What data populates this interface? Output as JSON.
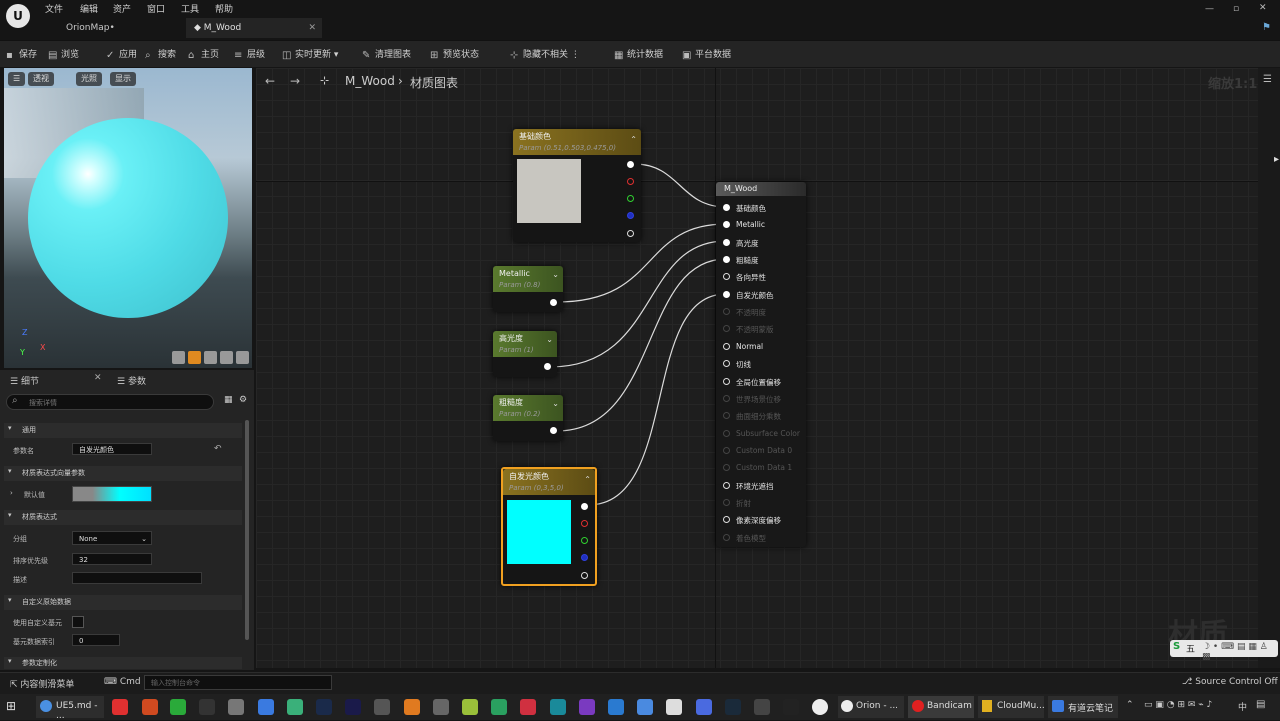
{
  "menubar": {
    "items": [
      "文件",
      "编辑",
      "资产",
      "窗口",
      "工具",
      "帮助"
    ],
    "tabs": [
      {
        "label": "OrionMap•"
      },
      {
        "label": "M_Wood"
      }
    ]
  },
  "toolbar": {
    "items": [
      "保存",
      "浏览",
      "应用",
      "搜索",
      "主页",
      "层级",
      "实时更新",
      "清理图表",
      "预览状态",
      "隐藏不相关",
      "统计数据",
      "平台数据"
    ]
  },
  "viewport": {
    "buttons": [
      "透视",
      "光照",
      "显示"
    ]
  },
  "details": {
    "tabs": [
      "细节",
      "参数"
    ],
    "search_placeholder": "搜索详情",
    "sections": {
      "general": "通用",
      "vector_param": "材质表达式向量参数",
      "expression": "材质表达式",
      "custom_primitive": "自定义原始数据",
      "param_custom": "参数定制化"
    },
    "param_name_label": "参数名",
    "param_name_value": "自发光颜色",
    "default_label": "默认值",
    "group_label": "分组",
    "group_value": "None",
    "priority_label": "排序优先级",
    "priority_value": "32",
    "desc_label": "描述",
    "use_custom_label": "使用自定义基元",
    "prim_index_label": "基元数据索引",
    "prim_index_value": "0"
  },
  "graph": {
    "breadcrumb_root": "M_Wood",
    "breadcrumb_child": "材质图表",
    "zoom_label": "缩放1:1",
    "watermark": "材质"
  },
  "nodes": {
    "base_color": {
      "title": "基础颜色",
      "sub": "Param (0.51,0.503,0.475,0)"
    },
    "metallic": {
      "title": "Metallic",
      "sub": "Param (0.8)"
    },
    "specular": {
      "title": "高光度",
      "sub": "Param (1)"
    },
    "roughness": {
      "title": "粗糙度",
      "sub": "Param (0.2)"
    },
    "emissive": {
      "title": "自发光颜色",
      "sub": "Param (0,3,5,0)"
    },
    "output": {
      "title": "M_Wood",
      "pins": [
        {
          "label": "基础颜色",
          "active": true,
          "filled": true
        },
        {
          "label": "Metallic",
          "active": true,
          "filled": true
        },
        {
          "label": "高光度",
          "active": true,
          "filled": true
        },
        {
          "label": "粗糙度",
          "active": true,
          "filled": true
        },
        {
          "label": "各向异性",
          "active": true,
          "filled": false
        },
        {
          "label": "自发光颜色",
          "active": true,
          "filled": true
        },
        {
          "label": "不透明度",
          "active": false,
          "filled": false
        },
        {
          "label": "不透明蒙版",
          "active": false,
          "filled": false
        },
        {
          "label": "Normal",
          "active": true,
          "filled": false
        },
        {
          "label": "切线",
          "active": true,
          "filled": false
        },
        {
          "label": "全局位置偏移",
          "active": true,
          "filled": false
        },
        {
          "label": "世界场景位移",
          "active": false,
          "filled": false
        },
        {
          "label": "曲面细分乘数",
          "active": false,
          "filled": false
        },
        {
          "label": "Subsurface Color",
          "active": false,
          "filled": false
        },
        {
          "label": "Custom Data 0",
          "active": false,
          "filled": false
        },
        {
          "label": "Custom Data 1",
          "active": false,
          "filled": false
        },
        {
          "label": "环境光遮挡",
          "active": true,
          "filled": false
        },
        {
          "label": "折射",
          "active": false,
          "filled": false
        },
        {
          "label": "像素深度偏移",
          "active": true,
          "filled": false
        },
        {
          "label": "着色模型",
          "active": false,
          "filled": false
        }
      ]
    }
  },
  "colors": {
    "base_swatch": "#c8c6c0",
    "emissive_swatch": "#00ffff",
    "vector_header": "#7a6418",
    "scalar_header": "#4f6b2a",
    "selection": "#f0a020"
  },
  "statusbar": {
    "drawer": "内容侧滑菜单",
    "cmd": "Cmd",
    "console_placeholder": "输入控制台命令",
    "source_control": "Source Control Off"
  },
  "taskbar": {
    "apps": [
      "UE5.md - ...",
      "Orion - ...",
      "Bandicam",
      "CloudMu...",
      "有道云笔记"
    ],
    "tray_text": "中"
  },
  "ime": {
    "label": "五"
  }
}
